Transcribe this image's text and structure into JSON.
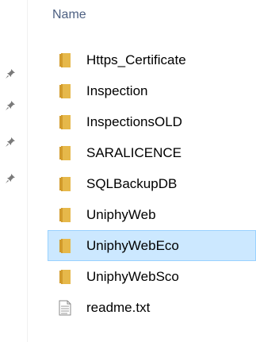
{
  "header": {
    "name_label": "Name"
  },
  "colors": {
    "folder_main": "#e6b84a",
    "folder_tab": "#d29b2c",
    "selection_bg": "#cce8ff",
    "selection_border": "#99d1ff",
    "header_text": "#4d6082",
    "pin_gray": "#7a7a7a"
  },
  "quick_access_pins": [
    {
      "icon": "pin-icon"
    },
    {
      "icon": "pin-icon"
    },
    {
      "icon": "pin-icon"
    },
    {
      "icon": "pin-icon"
    }
  ],
  "files": [
    {
      "name": "Https_Certificate",
      "type": "folder",
      "selected": false
    },
    {
      "name": "Inspection",
      "type": "folder",
      "selected": false
    },
    {
      "name": "InspectionsOLD",
      "type": "folder",
      "selected": false
    },
    {
      "name": "SARALICENCE",
      "type": "folder",
      "selected": false
    },
    {
      "name": "SQLBackupDB",
      "type": "folder",
      "selected": false
    },
    {
      "name": "UniphyWeb",
      "type": "folder",
      "selected": false
    },
    {
      "name": "UniphyWebEco",
      "type": "folder",
      "selected": true
    },
    {
      "name": "UniphyWebSco",
      "type": "folder",
      "selected": false
    },
    {
      "name": "readme.txt",
      "type": "text-file",
      "selected": false
    }
  ]
}
